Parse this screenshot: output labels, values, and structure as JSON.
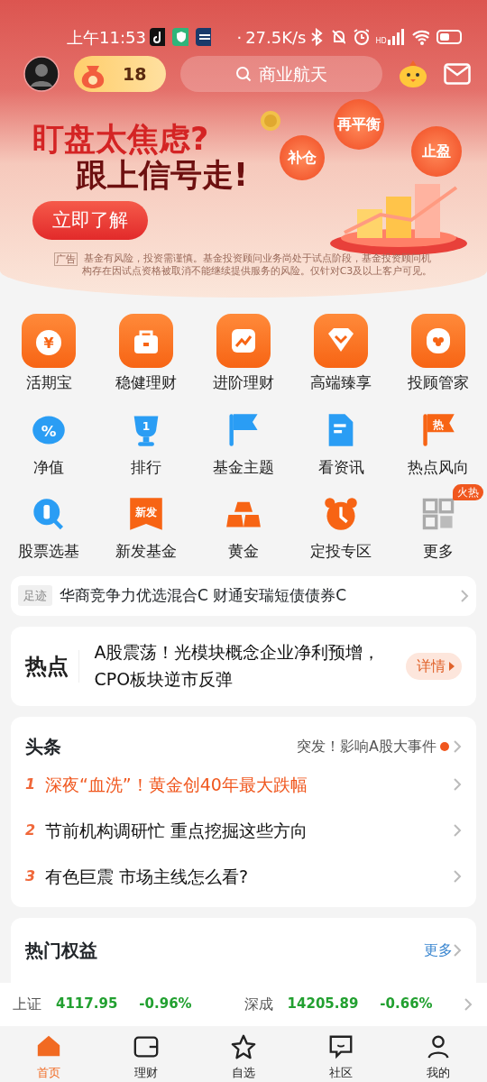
{
  "status_bar": {
    "time": "上午11:53",
    "dot": "·",
    "speed": "27.5K/s",
    "hd": "HD"
  },
  "header": {
    "coins": "18",
    "search": {
      "placeholder": "商业航天"
    }
  },
  "banner": {
    "line1": "盯盘太焦虑?",
    "line2": "跟上信号走!",
    "button": "立即了解",
    "tags": [
      "再平衡",
      "补仓",
      "止盈"
    ],
    "ad_label": "广告",
    "disclaimer": "基金有风险，投资需谨慎。基金投资顾问业务尚处于试点阶段，基金投资顾问机构存在因试点资格被取消不能继续提供服务的风险。仅针对C3及以上客户可见。"
  },
  "shortcuts": [
    {
      "kind": "large",
      "label": "活期宝",
      "icon_text": "¥"
    },
    {
      "kind": "large",
      "label": "稳健理财"
    },
    {
      "kind": "large",
      "label": "进阶理财"
    },
    {
      "kind": "large",
      "label": "高端臻享"
    },
    {
      "kind": "large",
      "label": "投顾管家"
    },
    {
      "kind": "small",
      "label": "净值",
      "icon_text": "%"
    },
    {
      "kind": "small",
      "label": "排行",
      "icon_text": "1"
    },
    {
      "kind": "small",
      "label": "基金主题"
    },
    {
      "kind": "small",
      "label": "看资讯"
    },
    {
      "kind": "small",
      "label": "热点风向",
      "icon_text": "热"
    },
    {
      "kind": "small",
      "label": "股票选基"
    },
    {
      "kind": "small",
      "label": "新发基金",
      "icon_text": "新发"
    },
    {
      "kind": "small",
      "label": "黄金"
    },
    {
      "kind": "small",
      "label": "定投专区"
    },
    {
      "kind": "small",
      "label": "更多",
      "badge": "火热"
    }
  ],
  "footprints": {
    "tag": "足迹",
    "text": "华商竞争力优选混合C 财通安瑞短债债券C"
  },
  "hot": {
    "logo": "热点",
    "text": "A股震荡！光模块概念企业净利预增，CPO板块逆市反弹",
    "button": "详情"
  },
  "headlines": {
    "title": "头条",
    "teaser": "突发！影响A股大事件",
    "items": [
      {
        "rank": "1",
        "text": "深夜“血洗”！黄金创40年最大跌幅",
        "hot": true
      },
      {
        "rank": "2",
        "text": "节前机构调研忙 重点挖掘这些方向",
        "hot": false
      },
      {
        "rank": "3",
        "text": "有色巨震 市场主线怎么看?",
        "hot": false
      }
    ]
  },
  "equity": {
    "title": "热门权益",
    "more": "更多"
  },
  "indices": [
    {
      "name": "上证",
      "value": "4117.95",
      "change": "-0.96%"
    },
    {
      "name": "深成",
      "value": "14205.89",
      "change": "-0.66%"
    }
  ],
  "tabs": [
    {
      "label": "首页",
      "selected": true
    },
    {
      "label": "理财",
      "selected": false
    },
    {
      "label": "自选",
      "selected": false
    },
    {
      "label": "社区",
      "selected": false
    },
    {
      "label": "我的",
      "selected": false
    }
  ]
}
